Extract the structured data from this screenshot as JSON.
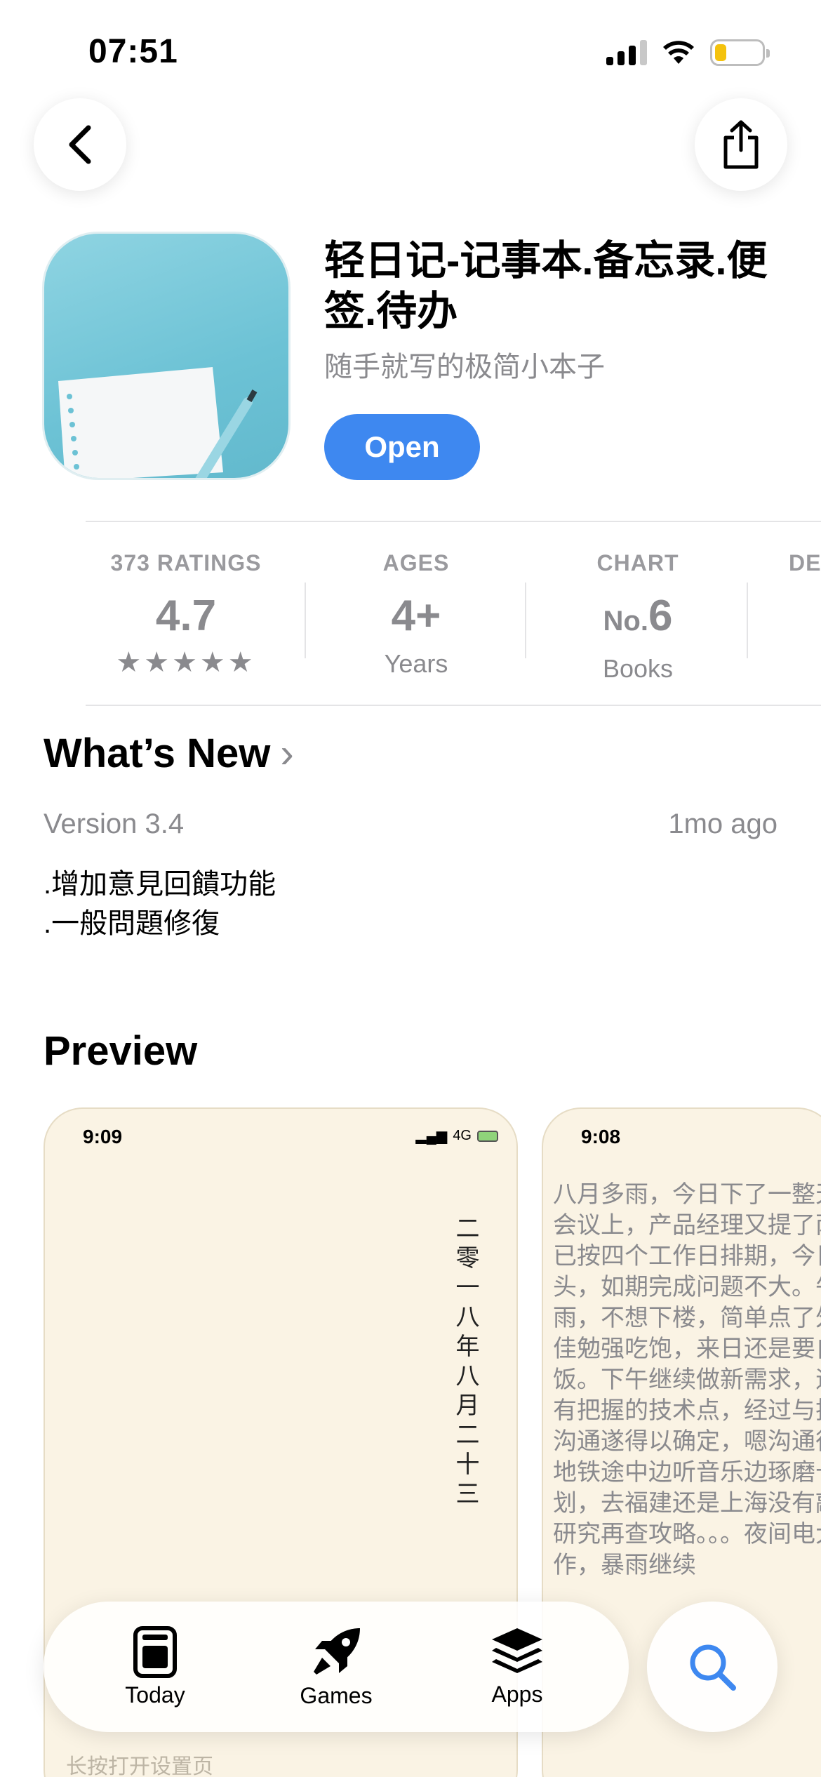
{
  "status_bar": {
    "time": "07:51"
  },
  "app": {
    "title": "轻日记-记事本.备忘录.便签.待办",
    "subtitle": "随手就写的极简小本子",
    "open_label": "Open"
  },
  "stats": [
    {
      "label": "373 RATINGS",
      "value": "4.7",
      "sub": "★★★★★"
    },
    {
      "label": "AGES",
      "value": "4+",
      "sub": "Years"
    },
    {
      "label": "CHART",
      "value_prefix": "No.",
      "value": "6",
      "sub": "Books"
    },
    {
      "label": "DE"
    }
  ],
  "whats_new": {
    "title": "What’s New",
    "version": "Version 3.4",
    "ago": "1mo ago",
    "notes": [
      ".增加意見回饋功能",
      ".一般問題修復"
    ]
  },
  "preview": {
    "title": "Preview",
    "shot1": {
      "time": "9:09",
      "network": "4G",
      "vertical": "二零一八年八月二十三",
      "hint": "长按打开设置页"
    },
    "shot2": {
      "time": "9:08",
      "body": "八月多雨，今日下了一整天会议上，产品经理又提了两已按四个工作日排期，今日头，如期完成问题不大。午雨，不想下楼，简单点了外佳勉强吃饱，来日还是要自饭。下午继续做新需求，遇有把握的技术点，经过与技沟通遂得以确定，嗯沟通很地铁途中边听音乐边琢磨十划，去福建还是上海没有敲研究再查攻略。。。夜间电大作，暴雨继续"
    }
  },
  "tabbar": {
    "today": "Today",
    "games": "Games",
    "apps": "Apps"
  },
  "colors": {
    "accent": "#3e88f0",
    "secondary_text": "#8a8a8e",
    "preview_bg": "#faf3e4"
  }
}
